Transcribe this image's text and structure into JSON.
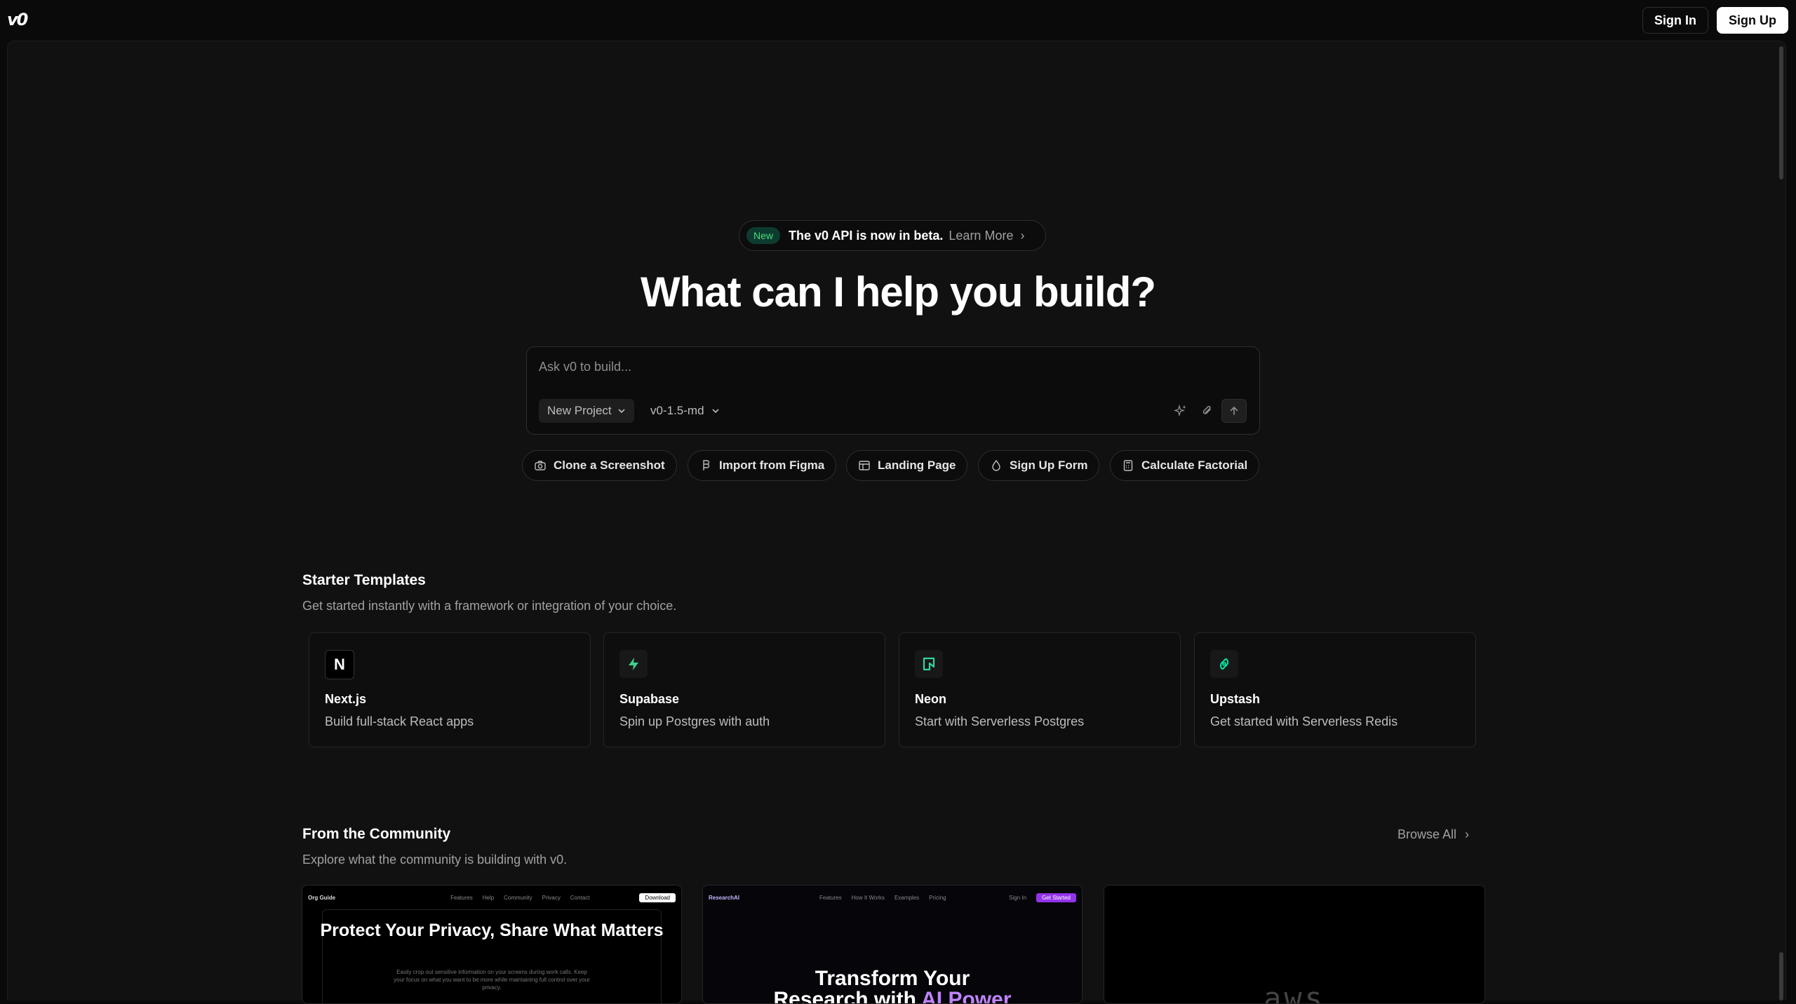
{
  "header": {
    "logo": "v0",
    "sign_in": "Sign In",
    "sign_up": "Sign Up"
  },
  "announcement": {
    "badge": "New",
    "text": "The v0 API is now in beta.",
    "link": "Learn More",
    "chevron": "›"
  },
  "hero": {
    "title": "What can I help you build?"
  },
  "prompt": {
    "placeholder": "Ask v0 to build...",
    "project_label": "New Project",
    "model_label": "v0-1.5-md",
    "icons": [
      "sparkle-icon",
      "paperclip-icon",
      "arrow-up-icon"
    ]
  },
  "suggestions": [
    {
      "label": "Clone a Screenshot",
      "icon": "camera-icon"
    },
    {
      "label": "Import from Figma",
      "icon": "figma-icon"
    },
    {
      "label": "Landing Page",
      "icon": "layout-icon"
    },
    {
      "label": "Sign Up Form",
      "icon": "droplet-icon"
    },
    {
      "label": "Calculate Factorial",
      "icon": "calculator-icon"
    }
  ],
  "starter": {
    "title": "Starter Templates",
    "subtitle": "Get started instantly with a framework or integration of your choice.",
    "cards": [
      {
        "name": "Next.js",
        "desc": "Build full-stack React apps",
        "icon": "nextjs-icon"
      },
      {
        "name": "Supabase",
        "desc": "Spin up Postgres with auth",
        "icon": "supabase-icon"
      },
      {
        "name": "Neon",
        "desc": "Start with Serverless Postgres",
        "icon": "neon-icon"
      },
      {
        "name": "Upstash",
        "desc": "Get started with Serverless Redis",
        "icon": "upstash-icon"
      }
    ]
  },
  "community": {
    "title": "From the Community",
    "subtitle": "Explore what the community is building with v0.",
    "browse_all": "Browse All",
    "browse_chevron": "›",
    "items": [
      {
        "title": "Protect Your Privacy, Share What Matters",
        "brand": "Org Guide",
        "nav": [
          "Features",
          "Help",
          "Community",
          "Privacy",
          "Contact"
        ],
        "cta": "Download",
        "body": "Easily crop out sensitive information on your screens during work calls. Keep your focus on what you want to be more while maintaining full control over your privacy."
      },
      {
        "title_line1": "Transform Your",
        "title_line2_a": "Research with ",
        "title_line2_b": "AI Power",
        "brand": "ResearchAI",
        "nav": [
          "Features",
          "How It Works",
          "Examples",
          "Pricing"
        ],
        "sign_in": "Sign In",
        "cta": "Get Started"
      },
      {
        "label": "aws"
      }
    ]
  },
  "colors": {
    "background": "#0a0a0a",
    "panel": "#111111",
    "badge_bg": "#0e3b2f",
    "badge_text": "#4ade80",
    "accent_purple": "#c084fc"
  }
}
